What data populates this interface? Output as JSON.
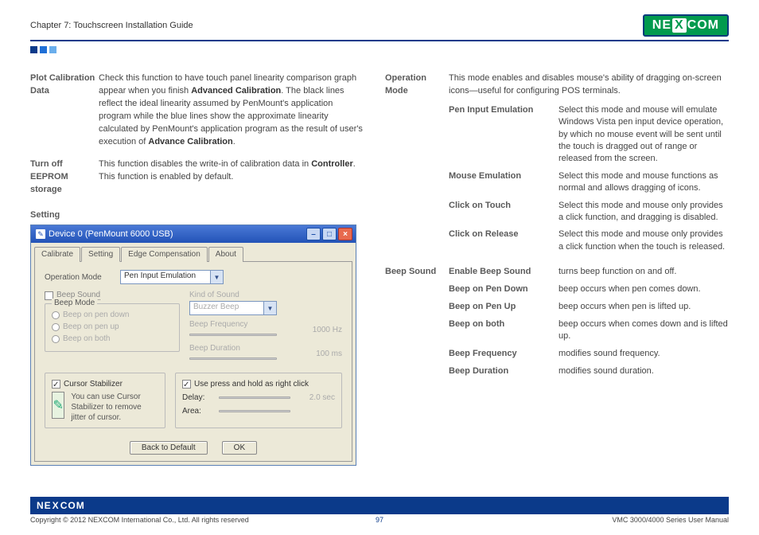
{
  "header": {
    "chapter": "Chapter 7: Touchscreen Installation Guide",
    "logo_text_1": "NE",
    "logo_text_2": "X",
    "logo_text_3": "COM"
  },
  "left": {
    "defs": [
      {
        "term": "Plot Calibration Data",
        "desc_before": "Check this function to have touch panel linearity comparison graph appear when you finish ",
        "bold1": "Advanced Calibration",
        "desc_mid": ". The black lines reflect the ideal linearity assumed by PenMount's application program while the blue lines show the approximate linearity calculated by PenMount's application program as the result of user's execution of ",
        "bold2": "Advance Calibration",
        "desc_after": "."
      },
      {
        "term": "Turn off EEPROM storage",
        "desc_before": "This function disables the write-in of calibration data in ",
        "bold1": "Controller",
        "desc_mid": ". This function is enabled by default.",
        "bold2": "",
        "desc_after": ""
      }
    ],
    "setting_heading": "Setting"
  },
  "dialog": {
    "title": "Device 0 (PenMount 6000 USB)",
    "tabs": [
      "Calibrate",
      "Setting",
      "Edge Compensation",
      "About"
    ],
    "active_tab": 1,
    "operation_mode_label": "Operation Mode",
    "operation_mode_value": "Pen Input Emulation",
    "beep_sound_label": "Beep Sound",
    "beep_mode_label": "Beep Mode",
    "beep_opts": [
      "Beep on pen down",
      "Beep on pen up",
      "Beep on both"
    ],
    "kind_label": "Kind of Sound",
    "kind_value": "Buzzer Beep",
    "freq_label": "Beep Frequency",
    "freq_value": "1000  Hz",
    "dur_label": "Beep Duration",
    "dur_value": "100   ms",
    "cursor_label": "Cursor Stabilizer",
    "cursor_hint": "You can use Cursor Stabilizer to remove jitter of cursor.",
    "press_label": "Use press and hold as right click",
    "delay_label": "Delay:",
    "delay_value": "2.0  sec",
    "area_label": "Area:",
    "back_btn": "Back to Default",
    "ok_btn": "OK"
  },
  "right": {
    "op_mode_term": "Operation Mode",
    "op_mode_desc": "This mode enables and disables mouse's ability of dragging on-screen icons—useful for configuring POS terminals.",
    "op_subs": [
      {
        "t": "Pen Input Emulation",
        "d": "Select this mode and mouse will emulate Windows Vista pen input device operation, by which no mouse event will be sent until the touch is dragged out of range or released from the screen."
      },
      {
        "t": "Mouse Emulation",
        "d": "Select this mode and mouse functions as normal and allows dragging of icons."
      },
      {
        "t": "Click on Touch",
        "d": "Select this mode and mouse only provides a click function, and dragging is disabled."
      },
      {
        "t": "Click on Release",
        "d": "Select this mode and mouse only provides a click function when the touch is released."
      }
    ],
    "beep_term": "Beep Sound",
    "beep_subs": [
      {
        "t": "Enable Beep Sound",
        "d": "turns beep function on and off."
      },
      {
        "t": "Beep on Pen Down",
        "d": "beep occurs when pen comes down."
      },
      {
        "t": "Beep on Pen Up",
        "d": "beep occurs when pen is lifted up."
      },
      {
        "t": "Beep on both",
        "d": "beep occurs when comes down and is lifted up."
      },
      {
        "t": "Beep Frequency",
        "d": "modifies sound frequency."
      },
      {
        "t": "Beep Duration",
        "d": "modifies sound duration."
      }
    ]
  },
  "footer": {
    "logo1": "NE",
    "logo2": "X",
    "logo3": "COM",
    "copyright": "Copyright © 2012 NEXCOM International Co., Ltd. All rights reserved",
    "page": "97",
    "manual": "VMC 3000/4000 Series User Manual"
  }
}
